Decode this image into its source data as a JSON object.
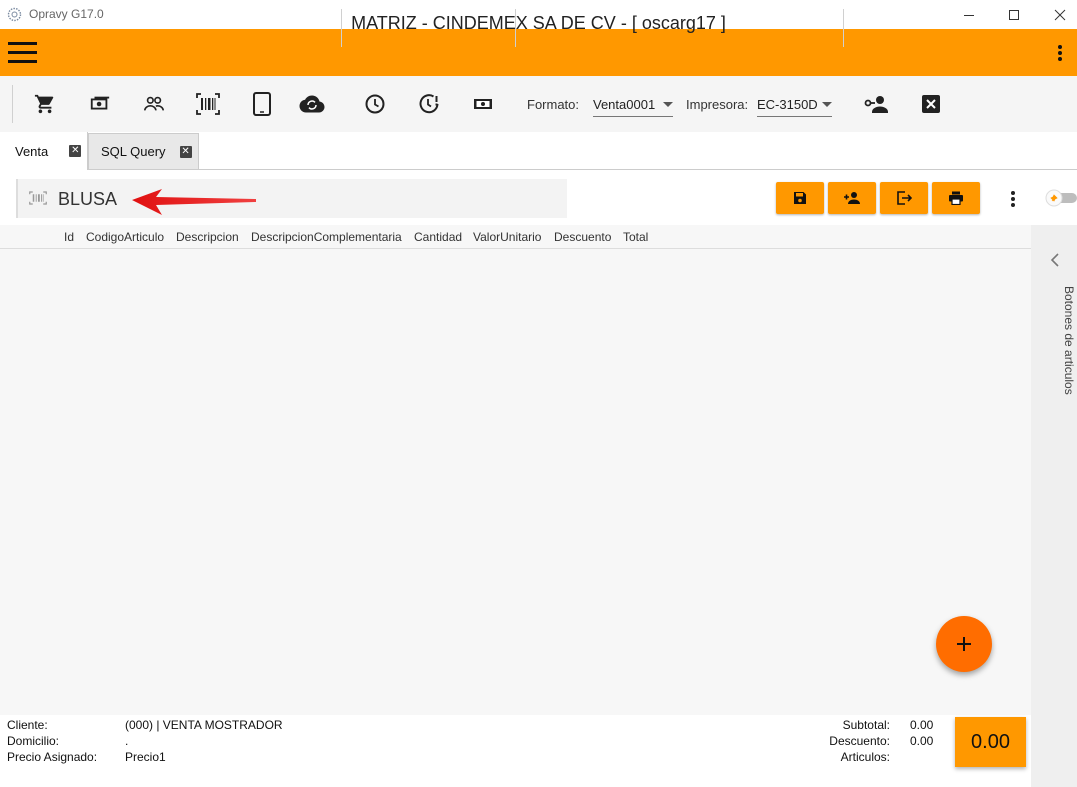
{
  "window": {
    "title": "Opravy G17.0"
  },
  "header": {
    "title": "MATRIZ - CINDEMEX SA DE CV - [ oscarg17 ]"
  },
  "toolbar": {
    "icons": [
      "cart-icon",
      "money-icon",
      "people-icon",
      "barcode-icon",
      "tablet-icon",
      "cloud-sync-icon",
      "clock-icon",
      "clock-alert-icon",
      "cash-icon",
      "person-key-icon",
      "close-box-icon"
    ],
    "formato_label": "Formato:",
    "formato_value": "Venta0001",
    "impresora_label": "Impresora:",
    "impresora_value": "EC-3150D"
  },
  "tabs": [
    {
      "label": "Venta",
      "active": true
    },
    {
      "label": "SQL Query",
      "active": false
    }
  ],
  "search": {
    "value": "BLUSA"
  },
  "actions": [
    "save-icon",
    "add-person-icon",
    "logout-icon",
    "print-icon"
  ],
  "grid": {
    "columns": [
      "Id",
      "CodigoArticulo",
      "Descripcion",
      "DescripcionComplementaria",
      "Cantidad",
      "ValorUnitario",
      "Descuento",
      "Total"
    ],
    "rows": []
  },
  "side_panel": {
    "label": "Botones de articulos"
  },
  "footer": {
    "cliente_label": "Cliente:",
    "cliente_value": "(000) | VENTA MOSTRADOR",
    "domicilio_label": "Domicilio:",
    "domicilio_value": ".",
    "precio_label": "Precio Asignado:",
    "precio_value": "Precio1",
    "subtotal_label": "Subtotal:",
    "subtotal_value": "0.00",
    "descuento_label": "Descuento:",
    "descuento_value": "0.00",
    "articulos_label": "Articulos:",
    "articulos_value": "",
    "total": "0.00"
  },
  "colors": {
    "accent": "#ff9800",
    "fab": "#ff6d00",
    "arrow": "#e81010"
  }
}
